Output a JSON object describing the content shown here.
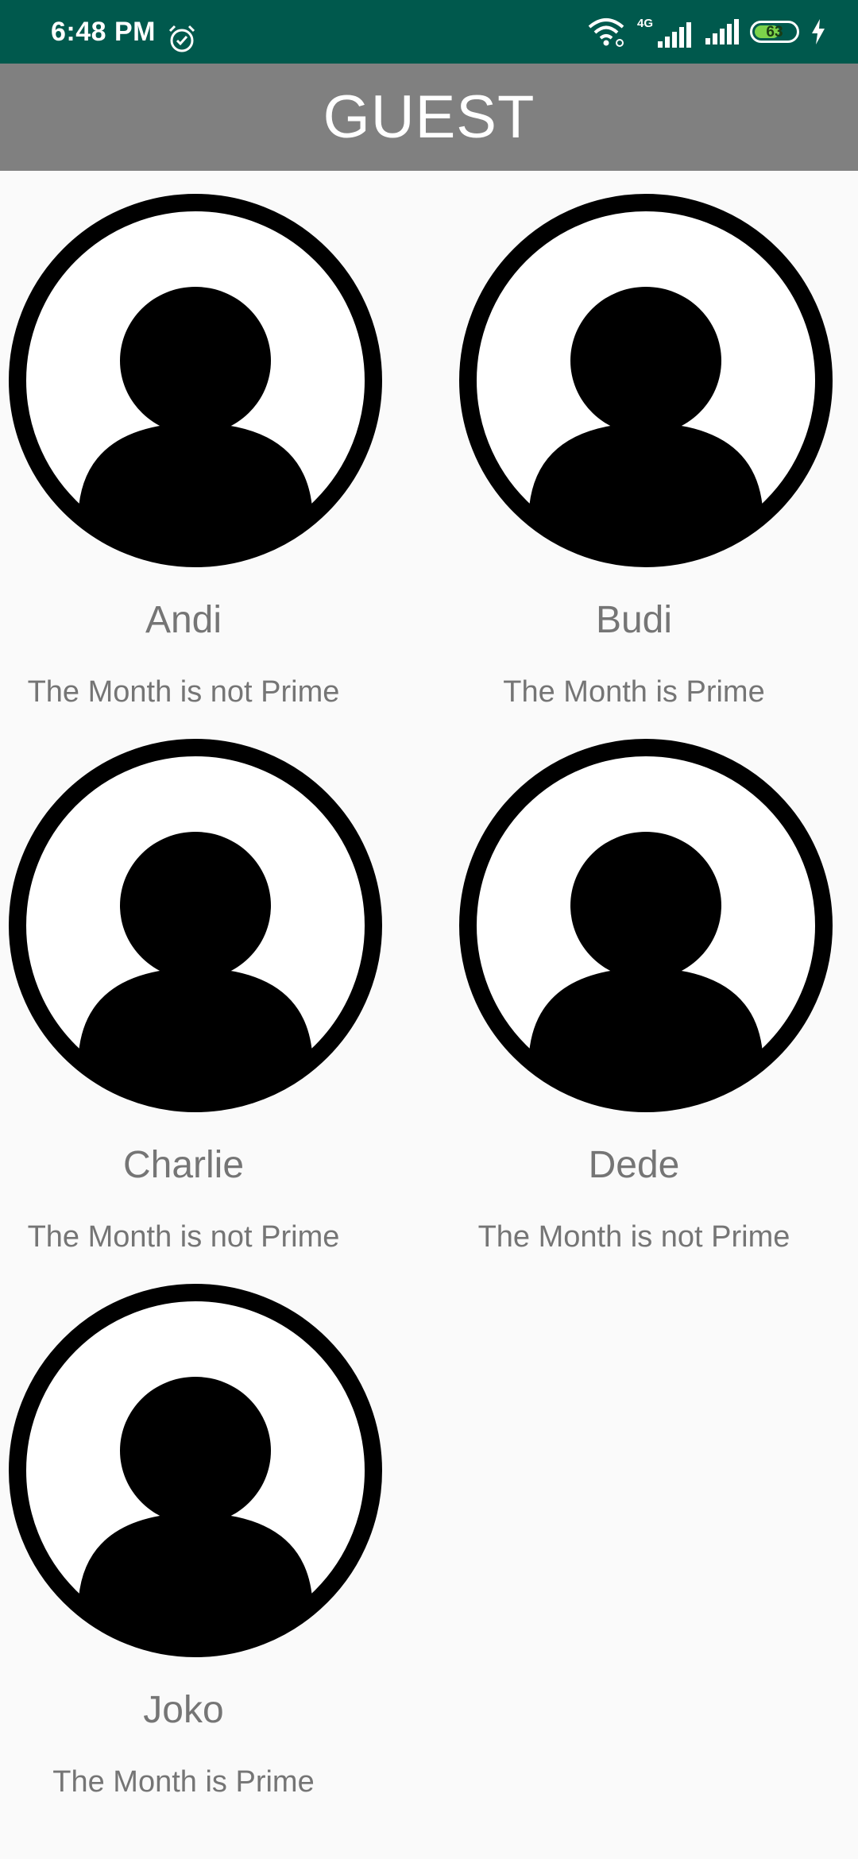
{
  "status_bar": {
    "time": "6:48 PM",
    "network_label": "4G",
    "battery_level": "63",
    "battery_fraction": 0.63,
    "icons": [
      "alarm-icon",
      "wifi-icon",
      "signal-4g-icon",
      "signal-icon",
      "battery-icon",
      "charging-icon"
    ]
  },
  "app_bar": {
    "title": "GUEST"
  },
  "guests": [
    {
      "name": "Andi",
      "status": "The Month is not Prime",
      "icon": "user-avatar-icon"
    },
    {
      "name": "Budi",
      "status": "The Month is Prime",
      "icon": "user-avatar-icon"
    },
    {
      "name": "Charlie",
      "status": "The Month is not Prime",
      "icon": "user-avatar-icon"
    },
    {
      "name": "Dede",
      "status": "The Month is not Prime",
      "icon": "user-avatar-icon"
    },
    {
      "name": "Joko",
      "status": "The Month is Prime",
      "icon": "user-avatar-icon"
    }
  ],
  "colors": {
    "status_bar": "#00594d",
    "app_bar": "#808080",
    "background": "#fafafa",
    "text_secondary": "#757575",
    "battery": "#7cd34b"
  }
}
